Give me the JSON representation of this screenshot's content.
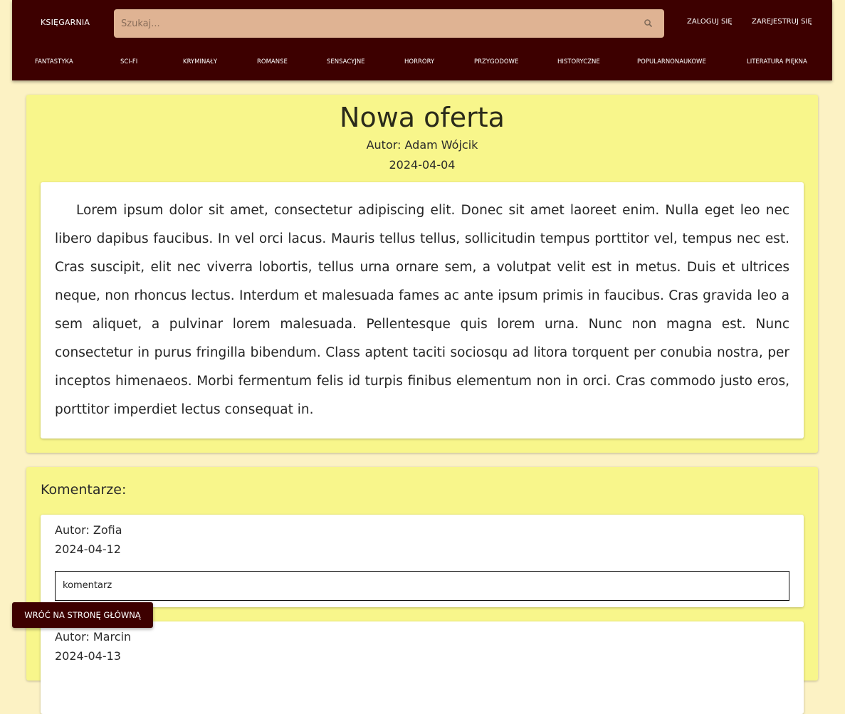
{
  "header": {
    "brand": "KSIĘGARNIA",
    "search_placeholder": "Szukaj...",
    "search_icon": "search-icon",
    "login": "ZALOGUJ SIĘ",
    "register": "ZAREJESTRUJ SIĘ",
    "categories": [
      "FANTASTYKA",
      "SCI-FI",
      "KRYMINAŁY",
      "ROMANSE",
      "SENSACYJNE",
      "HORRORY",
      "PRZYGODOWE",
      "HISTORYCZNE",
      "POPULARNONAUKOWE",
      "LITERATURA PIĘKNA"
    ]
  },
  "article": {
    "title": "Nowa oferta",
    "author": "Autor: Adam Wójcik",
    "date": "2024-04-04",
    "body": "Lorem ipsum dolor sit amet, consectetur adipiscing elit. Donec sit amet laoreet enim. Nulla eget leo nec libero dapibus faucibus. In vel orci lacus. Mauris tellus tellus, sollicitudin tempus porttitor vel, tempus nec est. Cras suscipit, elit nec viverra lobortis, tellus urna ornare sem, a volutpat velit est in metus. Duis et ultrices neque, non rhoncus lectus. Interdum et malesuada fames ac ante ipsum primis in faucibus. Cras gravida leo a sem aliquet, a pulvinar lorem malesuada. Pellentesque quis lorem urna. Nunc non magna est. Nunc consectetur in purus fringilla bibendum. Class aptent taciti sociosqu ad litora torquent per conubia nostra, per inceptos himenaeos. Morbi fermentum felis id turpis finibus elementum non in orci. Cras commodo justo eros, porttitor imperdiet lectus consequat in."
  },
  "comments": {
    "heading": "Komentarze:",
    "items": [
      {
        "author": "Autor: Zofia",
        "date": "2024-04-12",
        "text": "komentarz"
      },
      {
        "author": "Autor: Marcin",
        "date": "2024-04-13",
        "text": ""
      }
    ]
  },
  "back_button": "WRÓĆ NA STRONĘ GŁÓWNĄ",
  "colors": {
    "header_bg": "#3d0000",
    "search_bg": "#dfb393",
    "page_bg": "#fcf2c4",
    "card_bg": "#f8f68b"
  }
}
